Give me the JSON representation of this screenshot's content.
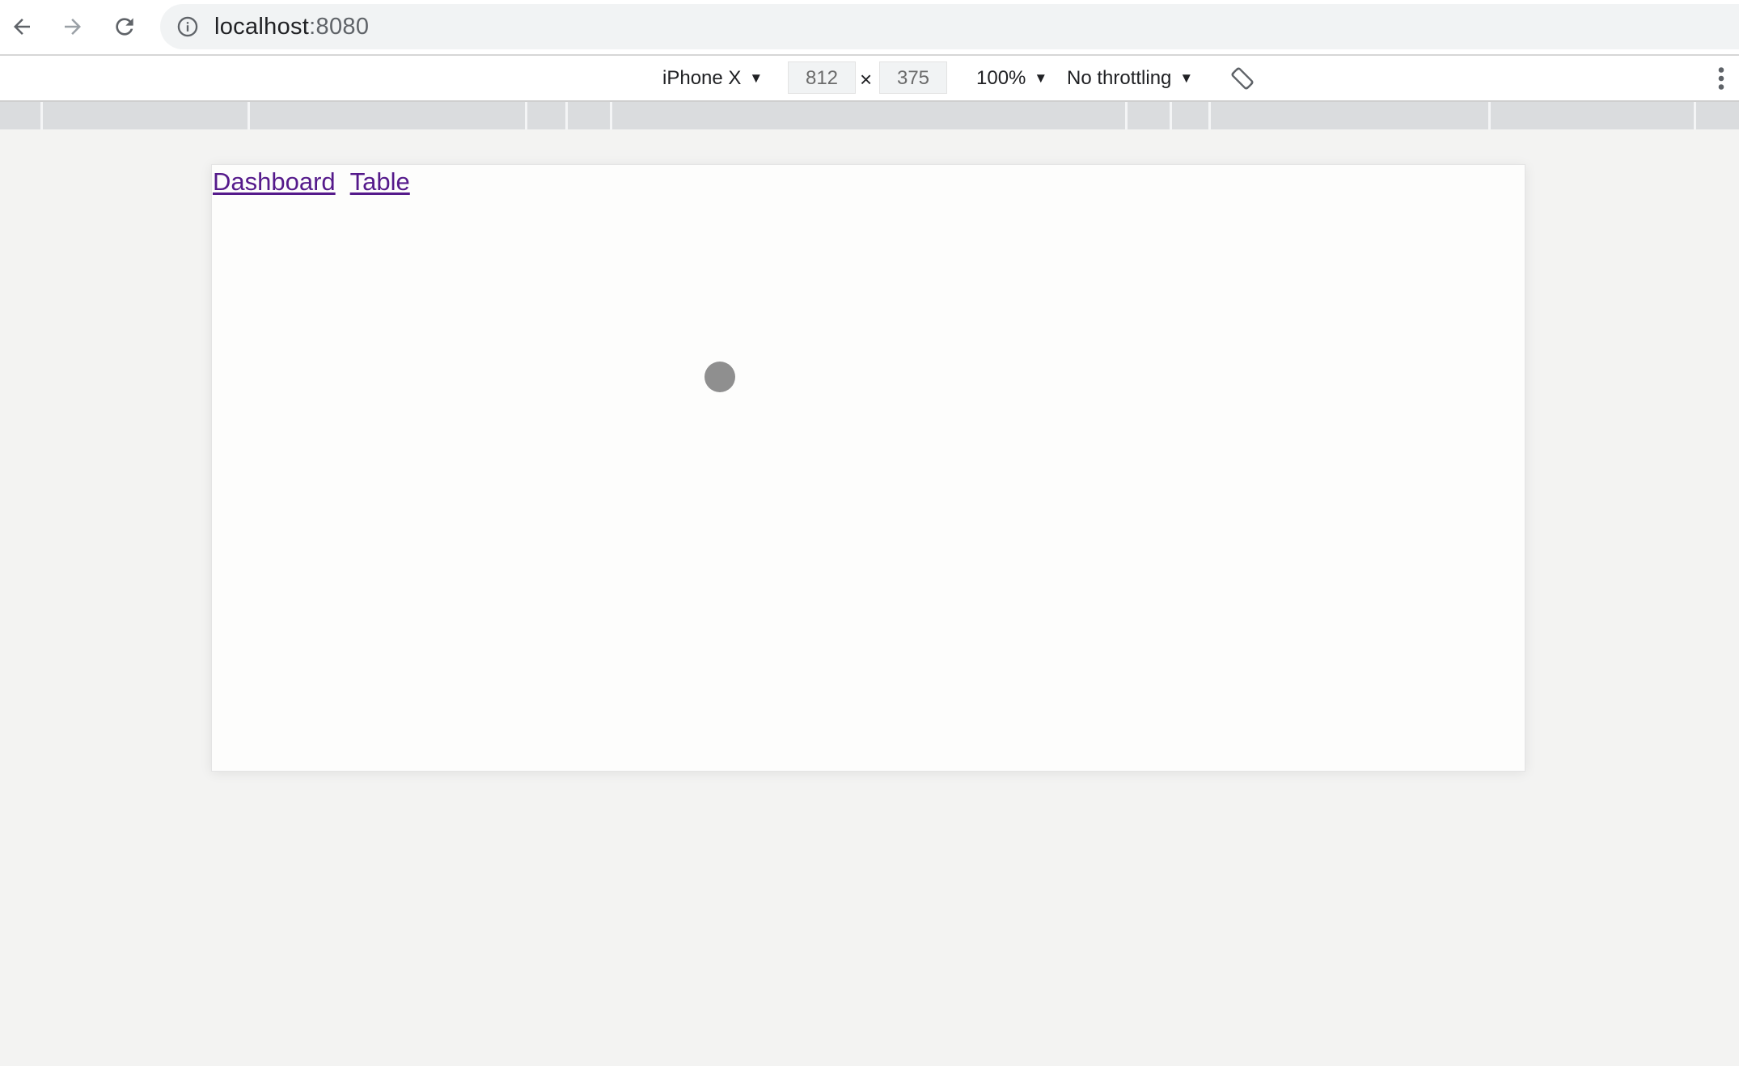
{
  "browser": {
    "url_host": "localhost",
    "url_port": ":8080",
    "icons": {
      "back": "arrow-left-icon",
      "forward": "arrow-right-icon",
      "reload": "reload-icon",
      "site_info": "info-circle-icon"
    }
  },
  "device_toolbar": {
    "device": "iPhone X",
    "width": "812",
    "times": "×",
    "height": "375",
    "zoom": "100%",
    "throttling": "No throttling",
    "caret": "▼"
  },
  "page": {
    "links": [
      {
        "label": "Dashboard"
      },
      {
        "label": "Table"
      }
    ],
    "link_color": "#551a8b"
  }
}
